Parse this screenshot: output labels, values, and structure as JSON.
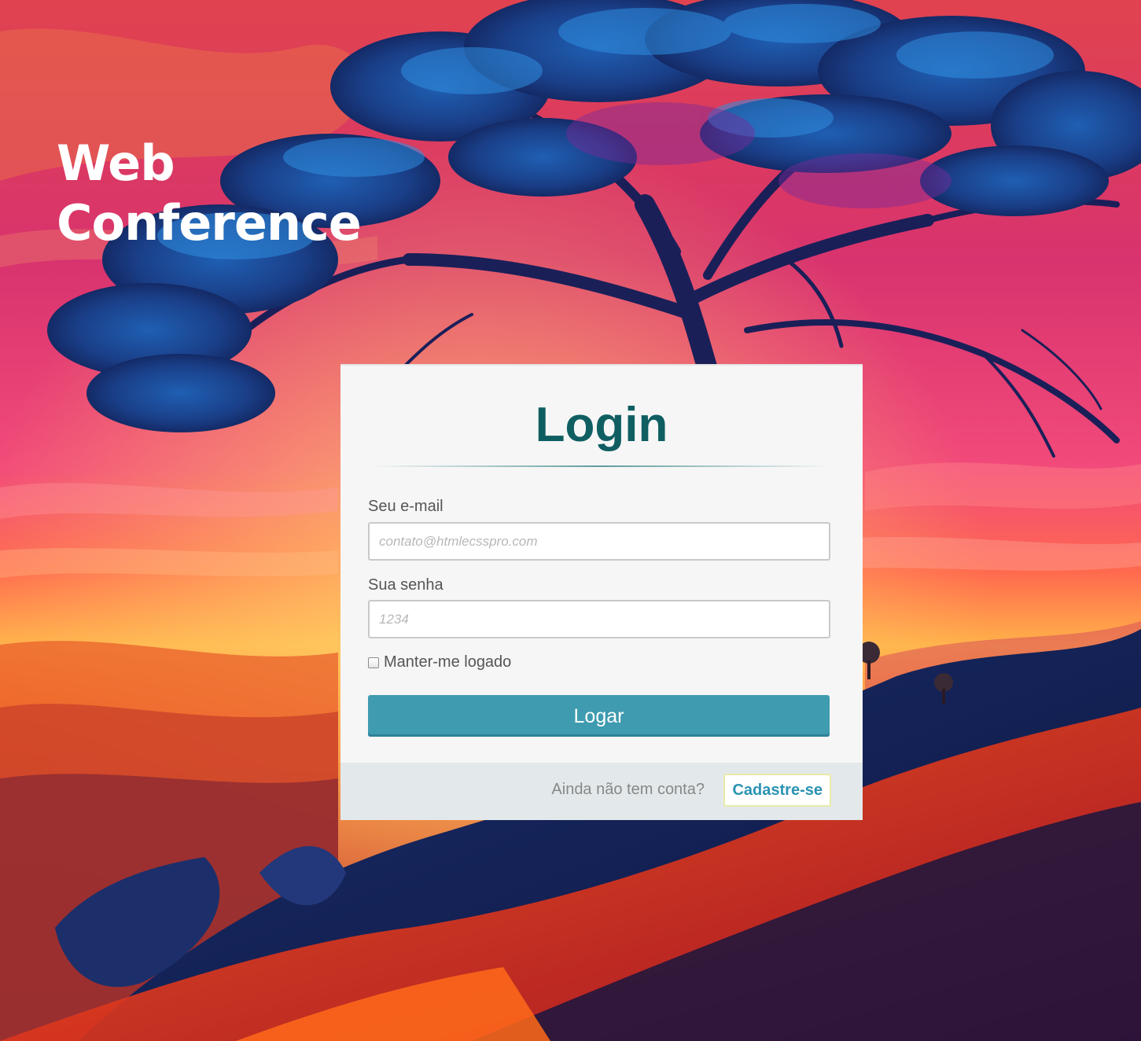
{
  "brand": {
    "line1": "Web",
    "line2": "Conference"
  },
  "background": {
    "description_icon": "sunset-tree-illustration"
  },
  "login": {
    "title": "Login",
    "email_label": "Seu e-mail",
    "email_placeholder": "contato@htmlecsspro.com",
    "email_value": "",
    "password_label": "Sua senha",
    "password_placeholder": "1234",
    "password_value": "",
    "remember_label": "Manter-me logado",
    "remember_checked": false,
    "submit_label": "Logar",
    "footer_text": "Ainda não tem conta?",
    "register_label": "Cadastre-se"
  },
  "colors": {
    "title": "#0f5e62",
    "button": "#3f9bb0",
    "register_link": "#2b93b3",
    "card_bg": "#f6f6f6",
    "footer_bg": "#e3e9ea"
  }
}
